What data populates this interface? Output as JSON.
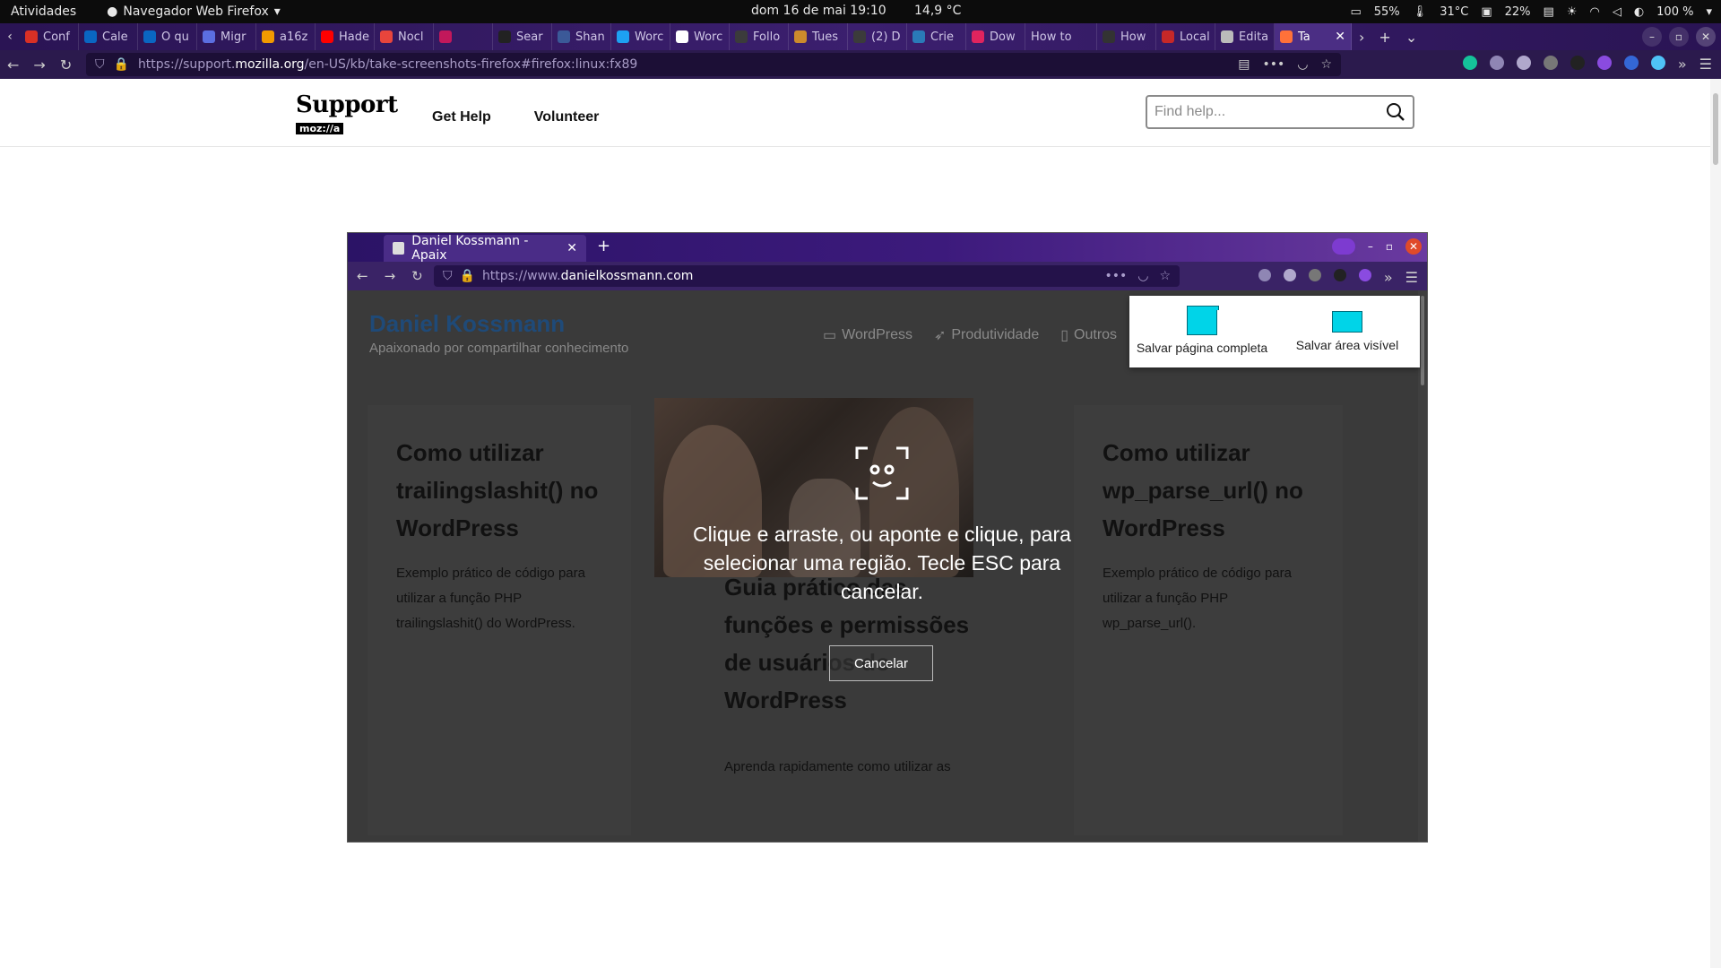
{
  "system_bar": {
    "activities": "Atividades",
    "app_name": "Navegador Web Firefox",
    "clock": "dom 16 de mai  19:10",
    "weather": "14,9 °C",
    "battery": "55%",
    "temp": "31°C",
    "disk": "22%",
    "volume": "100 %"
  },
  "browser": {
    "tabs": [
      {
        "label": "Conf",
        "color": "#d93025"
      },
      {
        "label": "Cale",
        "color": "#0a66c2"
      },
      {
        "label": "O qu",
        "color": "#0a66c2"
      },
      {
        "label": "Migr",
        "color": "#5b6ee1"
      },
      {
        "label": "a16z",
        "color": "#f29900"
      },
      {
        "label": "Hade",
        "color": "#ff0000"
      },
      {
        "label": "Nocl",
        "color": "#e8453c"
      },
      {
        "label": "",
        "color": "#c2185b"
      },
      {
        "label": "Sear",
        "color": "#222222"
      },
      {
        "label": "Shan",
        "color": "#3b5998"
      },
      {
        "label": "Worc",
        "color": "#1da1f2"
      },
      {
        "label": "Worc",
        "color": "#ffffff"
      },
      {
        "label": "Follo",
        "color": "#3b3b3b"
      },
      {
        "label": "Tues",
        "color": "#cc8a2c"
      },
      {
        "label": "(2) D",
        "color": "#3b3b3b"
      },
      {
        "label": "Crie",
        "color": "#2a7ab8"
      },
      {
        "label": "Dow",
        "color": "#e0245e"
      },
      {
        "label": "How to",
        "color": ""
      },
      {
        "label": "How",
        "color": "#333333"
      },
      {
        "label": "Local",
        "color": "#c62828"
      },
      {
        "label": "Edita",
        "color": "#bbbbbb"
      },
      {
        "label": "Ta",
        "color": "#ff7139"
      }
    ],
    "url_prefix": "https://support.",
    "url_host": "mozilla.org",
    "url_path": "/en-US/kb/take-screenshots-firefox#firefox:linux:fx89"
  },
  "site": {
    "logo_word": "Support",
    "logo_badge": "moz://a",
    "nav": [
      "Get Help",
      "Volunteer"
    ],
    "search_placeholder": "Find help..."
  },
  "screenshot": {
    "tab_title": "Daniel Kossmann - Apaix",
    "url_prefix": "https://www.",
    "url_host": "danielkossmann.com",
    "site_title": "Daniel Kossmann",
    "tagline": "Apaixonado por compartilhar conhecimento",
    "menu": [
      "WordPress",
      "Produtividade",
      "Outros"
    ],
    "cards": [
      {
        "title": "Como utilizar trailingslashit() no WordPress",
        "excerpt": "Exemplo prático de código para utilizar a função PHP trailingslashit() do WordPress."
      },
      {
        "title": "Guia prático das funções e permissões de usuários do WordPress",
        "excerpt": "Aprenda rapidamente como utilizar as"
      },
      {
        "title": "Como utilizar wp_parse_url() no WordPress",
        "excerpt": "Exemplo prático de código para utilizar a função PHP wp_parse_url()."
      }
    ],
    "instruction": "Clique e arraste, ou aponte e clique, para selecionar uma região. Tecle ESC para cancelar.",
    "cancel_label": "Cancelar",
    "save_full": "Salvar página completa",
    "save_visible": "Salvar área visível"
  }
}
